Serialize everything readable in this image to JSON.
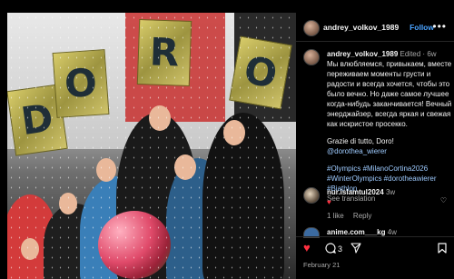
{
  "colors": {
    "accent": "#4aa3ff",
    "like_red": "#ff3040",
    "background": "#000000"
  },
  "post": {
    "author": "andrey_volkov_1989",
    "follow_label": "Follow",
    "more_icon": "more-horizontal-icon",
    "caption_author": "andrey_volkov_1989",
    "edited": "Edited",
    "age": "6w",
    "caption_text": "Мы влюбляемся, привыкаем, вместе переживаем моменты грусти и радости и всегда хочется, чтобы это было вечно. Но даже самое лучшее когда-нибудь заканчивается! Вечный энерджайзер, всегда яркая и свежая как искристое просекко.",
    "caption_line2": "Grazie di tutto, Doro!",
    "mention": "@dorothea_wierer",
    "hashtags": "#Olympics #MilanoCortina2026 #WinterOlympics #dorotheawierer #Biathlon",
    "see_translation": "See translation"
  },
  "photo": {
    "sign_letters": [
      "D",
      "O",
      "R",
      "O"
    ]
  },
  "comments": [
    {
      "user": "nur.islamtul2024",
      "age": "3w",
      "text": "♥",
      "likes": "1 like",
      "reply": "Reply"
    },
    {
      "user": "anime.com___kg",
      "age": "4w",
      "text": ""
    }
  ],
  "actions": {
    "like_icon": "heart-filled-icon",
    "comment_icon": "comment-icon",
    "comment_count": "3",
    "share_icon": "share-icon",
    "save_icon": "bookmark-icon"
  },
  "date": "February 21"
}
